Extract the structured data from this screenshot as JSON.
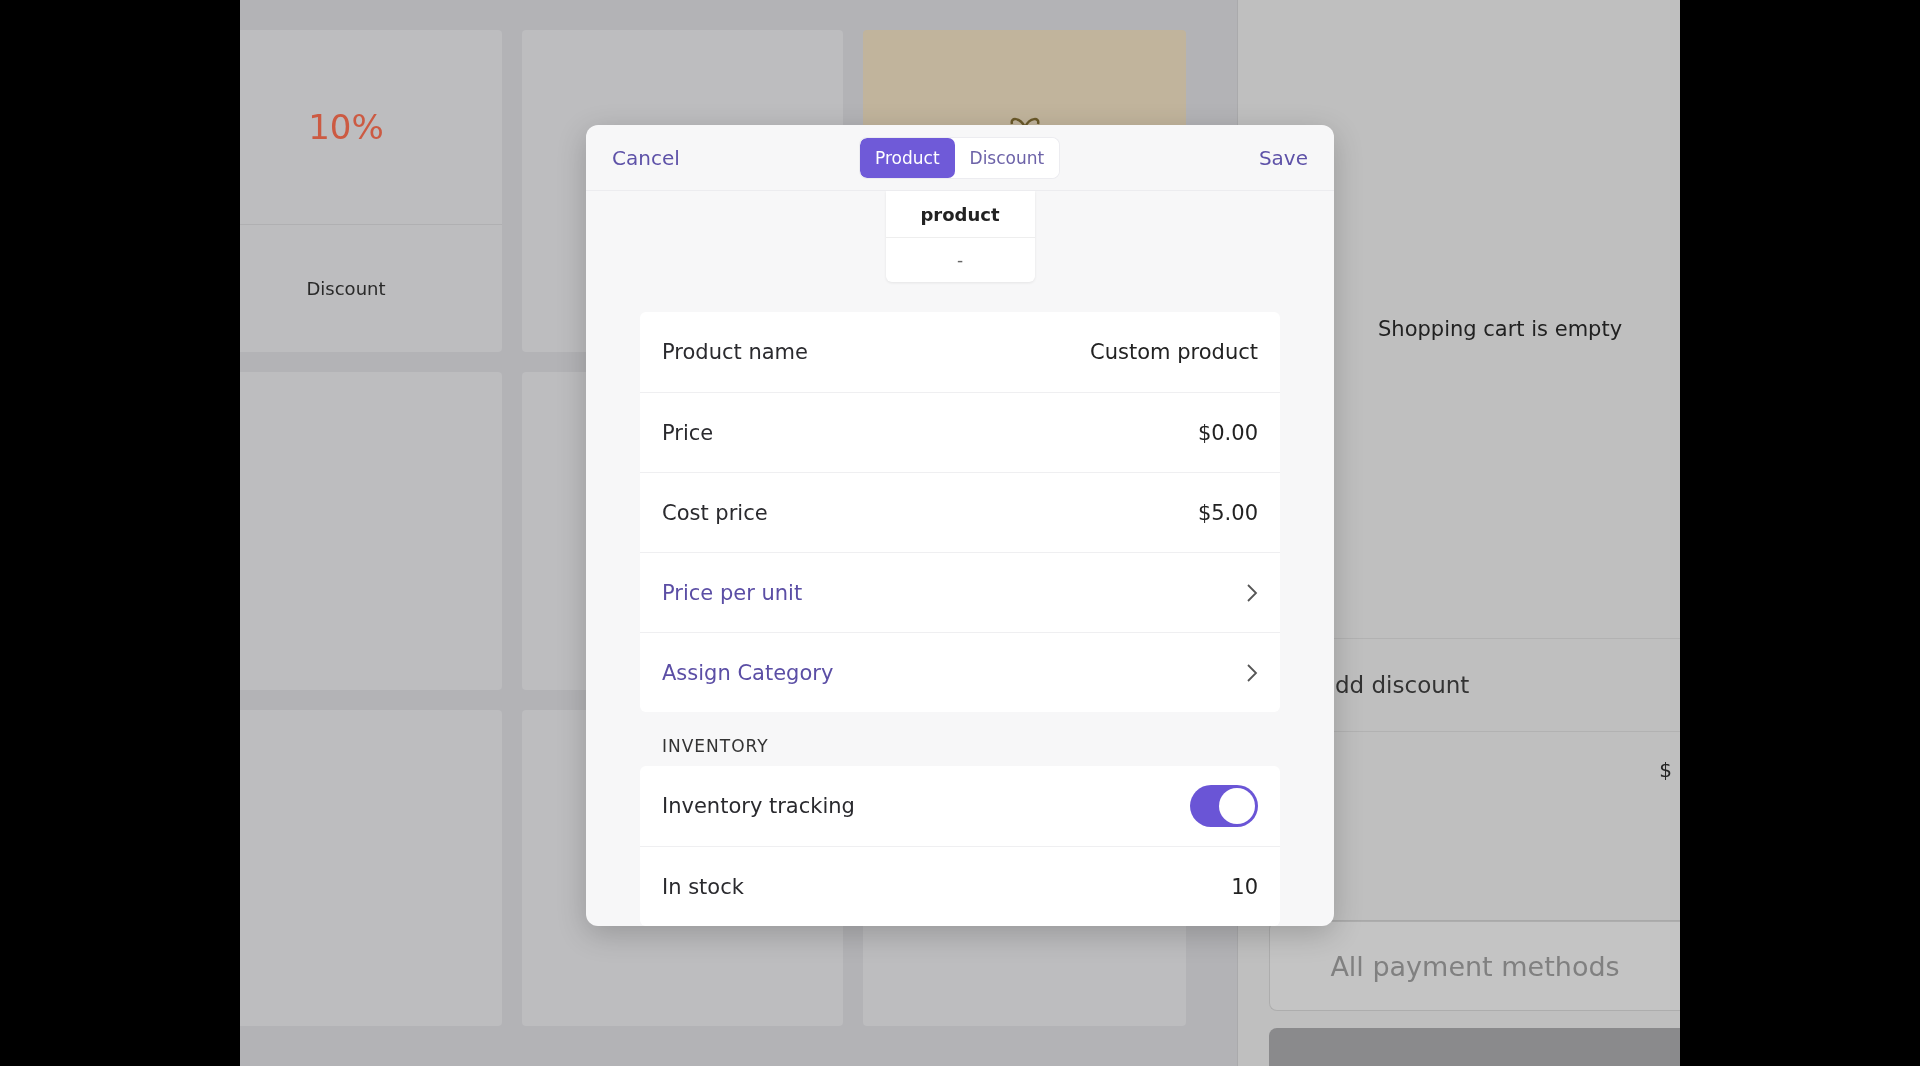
{
  "tiles": [
    {
      "kind": "discount",
      "value": "10%",
      "label": "Discount"
    },
    {
      "kind": "blank"
    },
    {
      "kind": "gift"
    }
  ],
  "cart": {
    "empty_message": "Shopping cart is empty",
    "discount_label": "dd discount",
    "total_currency": "$",
    "payment_button": "All payment methods"
  },
  "modal": {
    "cancel": "Cancel",
    "save": "Save",
    "tabs": [
      {
        "label": "Product",
        "selected": true
      },
      {
        "label": "Discount",
        "selected": false
      }
    ],
    "preview": {
      "name": "product",
      "price": "-"
    },
    "fields": [
      {
        "kind": "value",
        "label": "Product name",
        "value": "Custom product"
      },
      {
        "kind": "value",
        "label": "Price",
        "value": "$0.00"
      },
      {
        "kind": "value",
        "label": "Cost price",
        "value": "$5.00"
      },
      {
        "kind": "link",
        "label": "Price per unit"
      },
      {
        "kind": "link",
        "label": "Assign Category"
      }
    ],
    "inventory": {
      "heading": "INVENTORY",
      "rows": [
        {
          "kind": "toggle",
          "label": "Inventory tracking",
          "on": true
        },
        {
          "kind": "value",
          "label": "In stock",
          "value": "10"
        }
      ]
    }
  }
}
